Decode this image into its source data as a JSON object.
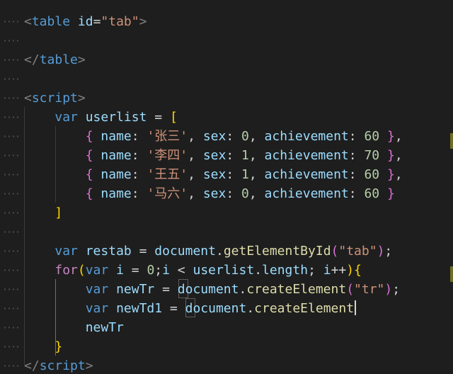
{
  "editor": {
    "language": "html",
    "theme_colors": {
      "background": "#1e1e1e",
      "tag": "#569cd6",
      "string": "#ce9178",
      "variable": "#9cdcfe",
      "function": "#dcdcaa",
      "number": "#b5cea8",
      "keyword": "#569cd6",
      "control": "#c586c0",
      "bracket": "#ffd700"
    },
    "lines": [
      {
        "tokens": [
          [
            "t-punc",
            "<"
          ],
          [
            "t-tag",
            "table"
          ],
          [
            "t-plain",
            " "
          ],
          [
            "t-attr",
            "id"
          ],
          [
            "t-plain",
            "="
          ],
          [
            "t-str",
            "\"tab\""
          ],
          [
            "t-punc",
            ">"
          ]
        ]
      },
      {
        "tokens": []
      },
      {
        "tokens": [
          [
            "t-punc",
            "</"
          ],
          [
            "t-tag",
            "table"
          ],
          [
            "t-punc",
            ">"
          ]
        ]
      },
      {
        "tokens": []
      },
      {
        "tokens": [
          [
            "t-punc",
            "<"
          ],
          [
            "t-tag",
            "script"
          ],
          [
            "t-punc",
            ">"
          ]
        ]
      },
      {
        "tokens": [
          [
            "t-plain",
            "    "
          ],
          [
            "t-kw",
            "var"
          ],
          [
            "t-plain",
            " "
          ],
          [
            "t-var",
            "userlist"
          ],
          [
            "t-plain",
            " = "
          ],
          [
            "t-brack1",
            "["
          ]
        ]
      },
      {
        "tokens": [
          [
            "t-plain",
            "        "
          ],
          [
            "t-brack2",
            "{"
          ],
          [
            "t-plain",
            " "
          ],
          [
            "t-prop",
            "name"
          ],
          [
            "t-plain",
            ": "
          ],
          [
            "t-str",
            "'张三'"
          ],
          [
            "t-plain",
            ", "
          ],
          [
            "t-prop",
            "sex"
          ],
          [
            "t-plain",
            ": "
          ],
          [
            "t-num",
            "0"
          ],
          [
            "t-plain",
            ", "
          ],
          [
            "t-prop",
            "achievement"
          ],
          [
            "t-plain",
            ": "
          ],
          [
            "t-num",
            "60"
          ],
          [
            "t-plain",
            " "
          ],
          [
            "t-brack2",
            "}"
          ],
          [
            "t-plain",
            ","
          ]
        ]
      },
      {
        "tokens": [
          [
            "t-plain",
            "        "
          ],
          [
            "t-brack2",
            "{"
          ],
          [
            "t-plain",
            " "
          ],
          [
            "t-prop",
            "name"
          ],
          [
            "t-plain",
            ": "
          ],
          [
            "t-str",
            "'李四'"
          ],
          [
            "t-plain",
            ", "
          ],
          [
            "t-prop",
            "sex"
          ],
          [
            "t-plain",
            ": "
          ],
          [
            "t-num",
            "1"
          ],
          [
            "t-plain",
            ", "
          ],
          [
            "t-prop",
            "achievement"
          ],
          [
            "t-plain",
            ": "
          ],
          [
            "t-num",
            "70"
          ],
          [
            "t-plain",
            " "
          ],
          [
            "t-brack2",
            "}"
          ],
          [
            "t-plain",
            ","
          ]
        ]
      },
      {
        "tokens": [
          [
            "t-plain",
            "        "
          ],
          [
            "t-brack2",
            "{"
          ],
          [
            "t-plain",
            " "
          ],
          [
            "t-prop",
            "name"
          ],
          [
            "t-plain",
            ": "
          ],
          [
            "t-str",
            "'王五'"
          ],
          [
            "t-plain",
            ", "
          ],
          [
            "t-prop",
            "sex"
          ],
          [
            "t-plain",
            ": "
          ],
          [
            "t-num",
            "1"
          ],
          [
            "t-plain",
            ", "
          ],
          [
            "t-prop",
            "achievement"
          ],
          [
            "t-plain",
            ": "
          ],
          [
            "t-num",
            "60"
          ],
          [
            "t-plain",
            " "
          ],
          [
            "t-brack2",
            "}"
          ],
          [
            "t-plain",
            ","
          ]
        ]
      },
      {
        "tokens": [
          [
            "t-plain",
            "        "
          ],
          [
            "t-brack2",
            "{"
          ],
          [
            "t-plain",
            " "
          ],
          [
            "t-prop",
            "name"
          ],
          [
            "t-plain",
            ": "
          ],
          [
            "t-str",
            "'马六'"
          ],
          [
            "t-plain",
            ", "
          ],
          [
            "t-prop",
            "sex"
          ],
          [
            "t-plain",
            ": "
          ],
          [
            "t-num",
            "0"
          ],
          [
            "t-plain",
            ", "
          ],
          [
            "t-prop",
            "achievement"
          ],
          [
            "t-plain",
            ": "
          ],
          [
            "t-num",
            "60"
          ],
          [
            "t-plain",
            " "
          ],
          [
            "t-brack2",
            "}"
          ]
        ]
      },
      {
        "tokens": [
          [
            "t-plain",
            "    "
          ],
          [
            "t-brack1",
            "]"
          ]
        ]
      },
      {
        "tokens": []
      },
      {
        "tokens": [
          [
            "t-plain",
            "    "
          ],
          [
            "t-kw",
            "var"
          ],
          [
            "t-plain",
            " "
          ],
          [
            "t-var",
            "restab"
          ],
          [
            "t-plain",
            " = "
          ],
          [
            "t-var",
            "document"
          ],
          [
            "t-plain",
            "."
          ],
          [
            "t-fn",
            "getElementById"
          ],
          [
            "t-brack2",
            "("
          ],
          [
            "t-str",
            "\"tab\""
          ],
          [
            "t-brack2",
            ")"
          ],
          [
            "t-plain",
            ";"
          ]
        ]
      },
      {
        "tokens": [
          [
            "t-plain",
            "    "
          ],
          [
            "t-ctrl",
            "for"
          ],
          [
            "t-brack1",
            "("
          ],
          [
            "t-kw",
            "var"
          ],
          [
            "t-plain",
            " "
          ],
          [
            "t-var",
            "i"
          ],
          [
            "t-plain",
            " = "
          ],
          [
            "t-num",
            "0"
          ],
          [
            "t-plain",
            ";"
          ],
          [
            "t-var",
            "i"
          ],
          [
            "t-plain",
            " < "
          ],
          [
            "t-var",
            "userlist"
          ],
          [
            "t-plain",
            "."
          ],
          [
            "t-prop",
            "length"
          ],
          [
            "t-plain",
            "; "
          ],
          [
            "t-var",
            "i"
          ],
          [
            "t-plain",
            "++"
          ],
          [
            "t-brack1",
            ")"
          ],
          [
            "t-brack1",
            "{"
          ]
        ]
      },
      {
        "tokens": [
          [
            "t-plain",
            "        "
          ],
          [
            "t-kw",
            "var"
          ],
          [
            "t-plain",
            " "
          ],
          [
            "t-var",
            "newTr"
          ],
          [
            "t-plain",
            " = "
          ],
          [
            "t-var",
            "document"
          ],
          [
            "t-plain",
            "."
          ],
          [
            "t-fn",
            "createElement"
          ],
          [
            "t-brack2",
            "("
          ],
          [
            "t-str",
            "\"tr\""
          ],
          [
            "t-brack2",
            ")"
          ],
          [
            "t-plain",
            ";"
          ]
        ]
      },
      {
        "tokens": [
          [
            "t-plain",
            "        "
          ],
          [
            "t-kw",
            "var"
          ],
          [
            "t-plain",
            " "
          ],
          [
            "t-var",
            "newTd1"
          ],
          [
            "t-plain",
            " = "
          ],
          [
            "t-var",
            "document"
          ],
          [
            "t-plain",
            "."
          ],
          [
            "t-fn",
            "createElement"
          ]
        ],
        "cursor": true
      },
      {
        "tokens": [
          [
            "t-plain",
            "        "
          ],
          [
            "t-var",
            "newTr"
          ]
        ]
      },
      {
        "tokens": [
          [
            "t-plain",
            "    "
          ],
          [
            "t-brack1",
            "}"
          ]
        ]
      },
      {
        "tokens": [
          [
            "t-punc",
            "</"
          ],
          [
            "t-tag",
            "script"
          ],
          [
            "t-punc",
            ">"
          ]
        ]
      }
    ]
  }
}
